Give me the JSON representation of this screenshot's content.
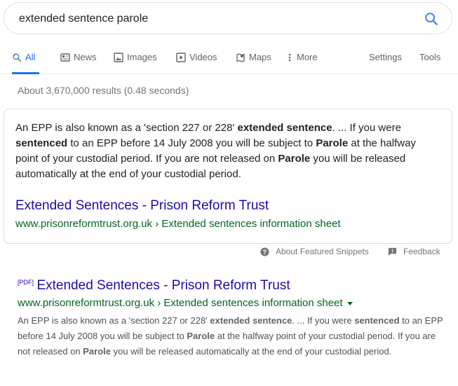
{
  "search": {
    "query": "extended sentence parole"
  },
  "tabs": [
    {
      "label": "All",
      "icon": "search-icon",
      "active": true
    },
    {
      "label": "News",
      "icon": "news-icon"
    },
    {
      "label": "Images",
      "icon": "images-icon"
    },
    {
      "label": "Videos",
      "icon": "videos-icon"
    },
    {
      "label": "Maps",
      "icon": "maps-icon"
    },
    {
      "label": "More",
      "icon": "more-vert-icon"
    },
    {
      "label": "Settings"
    },
    {
      "label": "Tools"
    }
  ],
  "stats": "About 3,670,000 results (0.48 seconds)",
  "featured_snippet": {
    "text_parts": [
      {
        "t": "An EPP is also known as a 'section 227 or 228' "
      },
      {
        "t": "extended sentence",
        "b": true
      },
      {
        "t": ". ... If you were "
      },
      {
        "t": "sentenced",
        "b": true
      },
      {
        "t": " to an EPP before 14 July 2008 you will be subject to "
      },
      {
        "t": "Parole",
        "b": true
      },
      {
        "t": " at the halfway point of your custodial period. If you are not released on "
      },
      {
        "t": "Parole",
        "b": true
      },
      {
        "t": " you will be released automatically at the end of your custodial period."
      }
    ],
    "title": "Extended Sentences - Prison Reform Trust",
    "url": "www.prisonreformtrust.org.uk › Extended sentences information sheet"
  },
  "snippet_footer": {
    "about_label": "About Featured Snippets",
    "feedback_label": "Feedback"
  },
  "result": {
    "tag": "[PDF]",
    "title": "Extended Sentences - Prison Reform Trust",
    "url": "www.prisonreformtrust.org.uk › Extended sentences information sheet",
    "desc_parts": [
      {
        "t": "An EPP is also known as a 'section 227 or 228' "
      },
      {
        "t": "extended sentence",
        "b": true
      },
      {
        "t": ". ... If you were "
      },
      {
        "t": "sentenced",
        "b": true
      },
      {
        "t": " to an EPP before 14 July 2008 you will be subject to "
      },
      {
        "t": "Parole",
        "b": true
      },
      {
        "t": " at the halfway point of your custodial period. If you are not released on "
      },
      {
        "t": "Parole",
        "b": true
      },
      {
        "t": " you will be released automatically at the end of your custodial period."
      }
    ]
  },
  "colors": {
    "link": "#1a0dab",
    "url_green": "#006621",
    "accent_blue": "#1a73e8",
    "muted": "#70757a"
  }
}
